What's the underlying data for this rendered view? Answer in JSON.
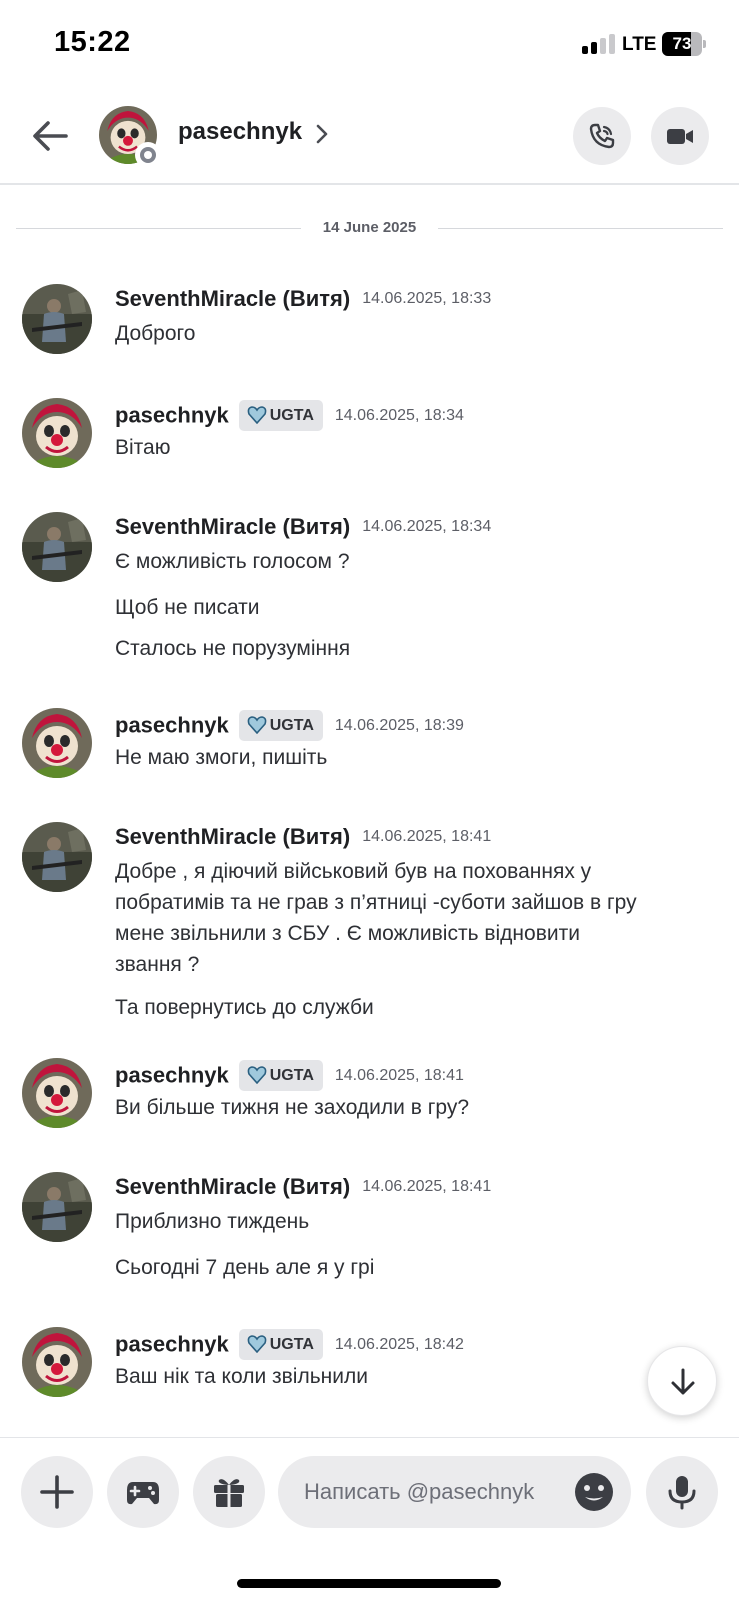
{
  "status_bar": {
    "time": "15:22",
    "network": "LTE",
    "battery": "73",
    "battery_level": 0.73
  },
  "header": {
    "contact_name": "pasechnyk"
  },
  "date_divider": "14 June 2025",
  "messages": [
    {
      "author": "SeventhMiracle (Витя)",
      "tag": "",
      "time": "14.06.2025, 18:33",
      "lines": [
        "Доброго"
      ]
    },
    {
      "author": "pasechnyk",
      "tag": "UGTA",
      "time": "14.06.2025, 18:34",
      "lines": [
        "Вітаю"
      ]
    },
    {
      "author": "SeventhMiracle (Витя)",
      "tag": "",
      "time": "14.06.2025, 18:34",
      "lines": [
        "Є можливість голосом ?",
        "Щоб не писати",
        "Сталось не порузуміння"
      ]
    },
    {
      "author": "pasechnyk",
      "tag": "UGTA",
      "time": "14.06.2025, 18:39",
      "lines": [
        "Не маю змоги, пишіть"
      ]
    },
    {
      "author": "SeventhMiracle (Витя)",
      "tag": "",
      "time": "14.06.2025, 18:41",
      "lines": [
        "Добре , я діючий військовий був на похованнях у",
        "побратимів та не грав з п’ятниці -суботи зайшов в гру",
        "мене звільнили з СБУ . Є можливість відновити",
        "звання ?",
        "Та повернутись до служби"
      ]
    },
    {
      "author": "pasechnyk",
      "tag": "UGTA",
      "time": "14.06.2025, 18:41",
      "lines": [
        "Ви більше тижня не заходили в гру?"
      ]
    },
    {
      "author": "SeventhMiracle (Витя)",
      "tag": "",
      "time": "14.06.2025, 18:41",
      "lines": [
        "Приблизно тиждень",
        "Сьогодні 7 день але я у грі"
      ]
    },
    {
      "author": "pasechnyk",
      "tag": "UGTA",
      "time": "14.06.2025, 18:42",
      "lines": [
        "Ваш нік та коли звільнили"
      ]
    }
  ],
  "composer": {
    "placeholder": "Написать @pasechnyk"
  },
  "icons": {
    "back": "arrow-left-icon",
    "call": "phone-icon",
    "video": "video-camera-icon",
    "plus": "plus-icon",
    "games": "gamepad-icon",
    "gift": "gift-icon",
    "emoji": "smiley-icon",
    "mic": "microphone-icon",
    "jump": "arrow-down-icon",
    "tag": "heart-icon"
  },
  "colors": {
    "background": "#ffffff",
    "text": "#1f2023",
    "muted": "#5c5e66",
    "button_bg": "#ebebed",
    "status_offline": "#80848e"
  }
}
